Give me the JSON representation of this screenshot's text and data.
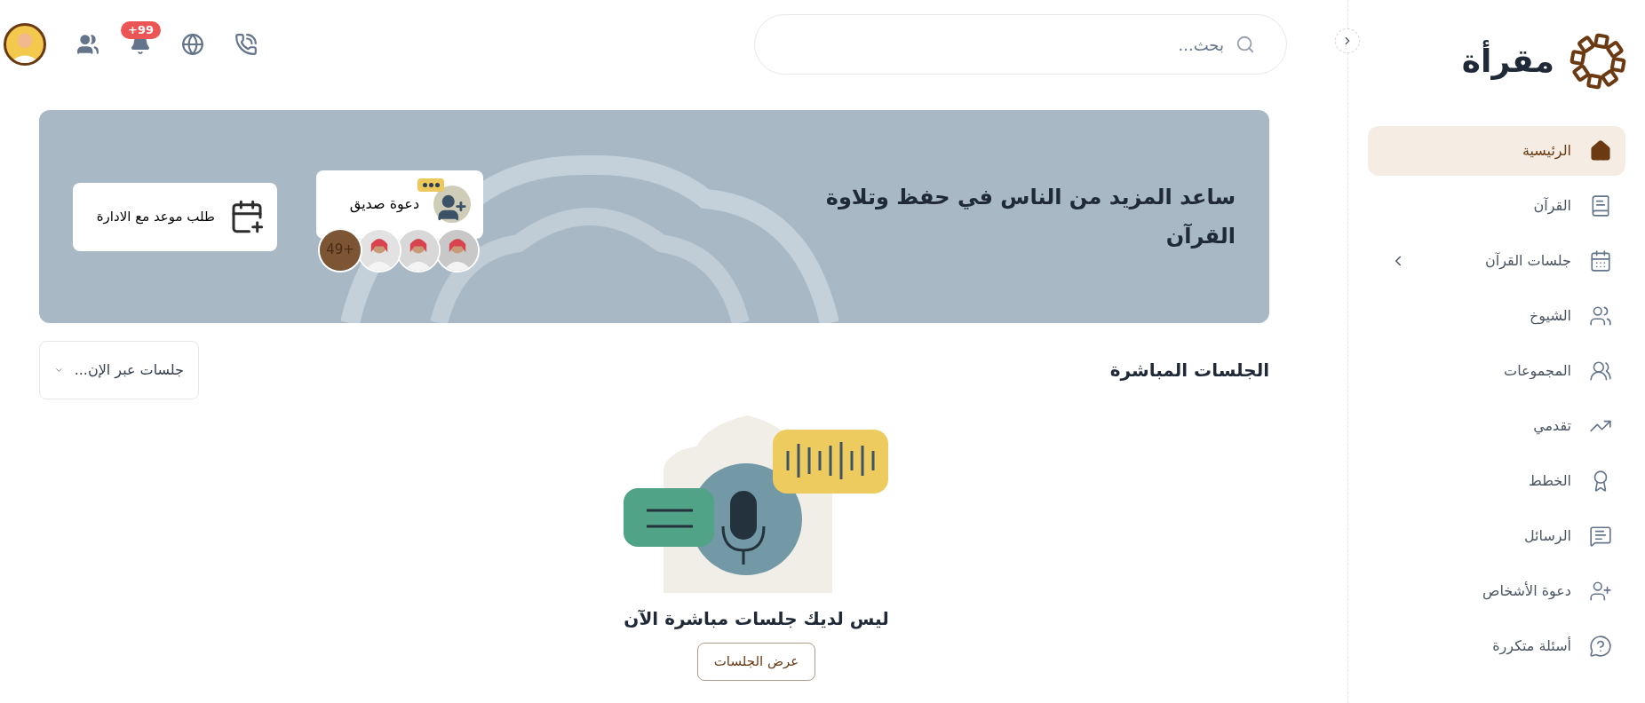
{
  "header": {
    "search": {
      "placeholder": "بحث..."
    },
    "notifications_badge": "+99"
  },
  "sidebar": {
    "logo": "مقرأة",
    "items": [
      {
        "label": "الرئيسية",
        "selected": true,
        "has_submenu": false
      },
      {
        "label": "القرآن",
        "selected": false,
        "has_submenu": false
      },
      {
        "label": "جلسات القرآن",
        "selected": false,
        "has_submenu": true
      },
      {
        "label": "الشيوخ",
        "selected": false,
        "has_submenu": false
      },
      {
        "label": "المجموعات",
        "selected": false,
        "has_submenu": false
      },
      {
        "label": "تقدمي",
        "selected": false,
        "has_submenu": false
      },
      {
        "label": "الخطط",
        "selected": false,
        "has_submenu": false
      },
      {
        "label": "الرسائل",
        "selected": false,
        "has_submenu": false
      },
      {
        "label": "دعوة الأشخاص",
        "selected": false,
        "has_submenu": false
      },
      {
        "label": "أسئلة متكررة",
        "selected": false,
        "has_submenu": false
      }
    ]
  },
  "banner": {
    "title": "ساعد المزيد من الناس في حفظ وتلاوة القرآن",
    "invite_button": "دعوة صديق",
    "appointment_button": "طلب موعد مع الادارة",
    "avatars": [
      {
        "kind": "picture"
      },
      {
        "kind": "picture"
      },
      {
        "kind": "picture"
      },
      {
        "kind": "count",
        "label": "+49"
      }
    ]
  },
  "live_sessions": {
    "title": "الجلسات المباشرة",
    "filter": "جلسات عبر الإن...",
    "empty_message": "ليس لديك جلسات مباشرة الآن",
    "view_button": "عرض الجلسات"
  }
}
